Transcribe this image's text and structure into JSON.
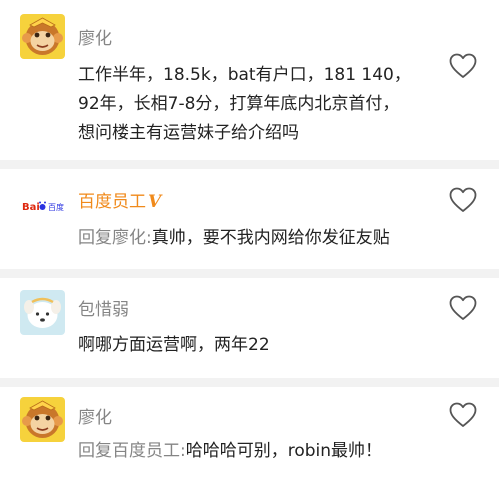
{
  "comments": [
    {
      "user": "廖化",
      "lines": [
        "工作半年，18.5k，bat有户口，181 140，",
        "92年，长相7-8分，打算年底内北京首付，",
        "想问楼主有运营妹子给介绍吗"
      ]
    },
    {
      "user": "百度员工",
      "badge": "V",
      "avatar_text": "Bai百度",
      "reply_prefix": "回复廖化:",
      "reply_text": "真帅，要不我内网给你发征友贴"
    },
    {
      "user": "包惜弱",
      "text": "啊哪方面运营啊，两年22"
    },
    {
      "user": "廖化",
      "reply_prefix": "回复百度员工:",
      "reply_text": "哈哈哈可别，robin最帅！"
    }
  ],
  "icons": {
    "like": "heart-outline-icon",
    "avatar_monkey": "monkey-avatar",
    "avatar_dog": "dog-avatar",
    "avatar_baidu": "baidu-logo"
  },
  "colors": {
    "username": "#858585",
    "vip_username": "#f08a1b",
    "text": "#222222",
    "separator": "#f2f2f2"
  }
}
